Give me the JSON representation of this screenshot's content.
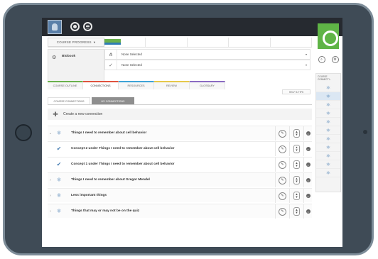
{
  "header": {
    "course_progress_label": "COURSE PROGRESS",
    "progress": 0.12
  },
  "selection": {
    "module_label": "Biobook",
    "rows": [
      {
        "icon": "network-icon",
        "text": "None Selected"
      },
      {
        "icon": "check-icon",
        "text": "None Selected"
      }
    ]
  },
  "tabs": [
    {
      "label": "COURSE OUTLINE",
      "color": "#6ab04c"
    },
    {
      "label": "CONNECTIONS",
      "color": "#e0533f",
      "active": true
    },
    {
      "label": "RESOURCES",
      "color": "#3fa3d6"
    },
    {
      "label": "REVIEW",
      "color": "#e6c84a"
    },
    {
      "label": "GLOSSARY",
      "color": "#8a6bc2"
    }
  ],
  "help_tips": "HELP & TIPS",
  "subtabs": [
    {
      "label": "COURSE CONNECTIONS"
    },
    {
      "label": "MY CONNECTIONS",
      "active": true
    }
  ],
  "create_connection": "Create a new connection",
  "connections": [
    {
      "label": "Things I need to remember about cell behavior",
      "icon": "network-icon",
      "chevron": "⌄",
      "child": false
    },
    {
      "label": "Concept 2 under Things I need to remember about cell behavior",
      "icon": "check-icon",
      "chevron": "",
      "child": true
    },
    {
      "label": "Concept 1 under Things I need to remember about cell behavior",
      "icon": "check-icon",
      "chevron": "",
      "child": true
    },
    {
      "label": "Things I need to remember about Gregor Mendel",
      "icon": "network-icon",
      "chevron": "›",
      "child": false
    },
    {
      "label": "Less important things",
      "icon": "network-icon",
      "chevron": "›",
      "child": false
    },
    {
      "label": "Things that may or may not be on the quiz",
      "icon": "network-icon",
      "chevron": "›",
      "child": false
    }
  ],
  "rail": {
    "title": "COURSE CONNECTI...",
    "items": 11
  },
  "colors": {
    "brand_green": "#5fb446",
    "topbar": "#262a30",
    "tablet_frame": "#3f4b56"
  }
}
